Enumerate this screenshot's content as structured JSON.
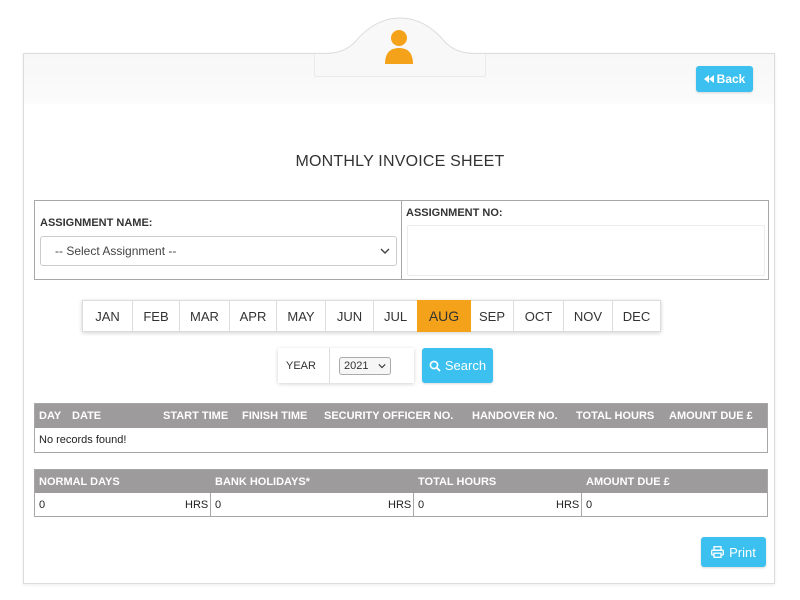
{
  "header": {
    "back_label": "Back",
    "title": "MONTHLY INVOICE SHEET"
  },
  "assignment": {
    "name_label": "ASSIGNMENT NAME:",
    "select_value": "-- Select Assignment --",
    "no_label": "ASSIGNMENT NO:",
    "no_value": ""
  },
  "months": [
    "JAN",
    "FEB",
    "MAR",
    "APR",
    "MAY",
    "JUN",
    "JUL",
    "AUG",
    "SEP",
    "OCT",
    "NOV",
    "DEC"
  ],
  "active_month": "AUG",
  "year": {
    "label": "YEAR",
    "value": "2021",
    "search_label": "Search"
  },
  "records_table": {
    "columns": [
      "DAY",
      "DATE",
      "START TIME",
      "FINISH TIME",
      "SECURITY OFFICER NO.",
      "HANDOVER NO.",
      "TOTAL HOURS",
      "AMOUNT DUE £"
    ],
    "empty_message": "No records found!"
  },
  "totals_table": {
    "columns": [
      "NORMAL DAYS",
      "BANK HOLIDAYS*",
      "TOTAL HOURS",
      "AMOUNT DUE £"
    ],
    "values": {
      "normal_days": "0",
      "bank_holidays": "0",
      "total_hours": "0",
      "amount_due": "0"
    },
    "unit": "HRS"
  },
  "footer": {
    "print_label": "Print"
  },
  "colors": {
    "accent": "#3bc0ef",
    "active_month": "#f5a21b",
    "header_gray": "#9d9b9b",
    "avatar": "#f5a21b"
  }
}
